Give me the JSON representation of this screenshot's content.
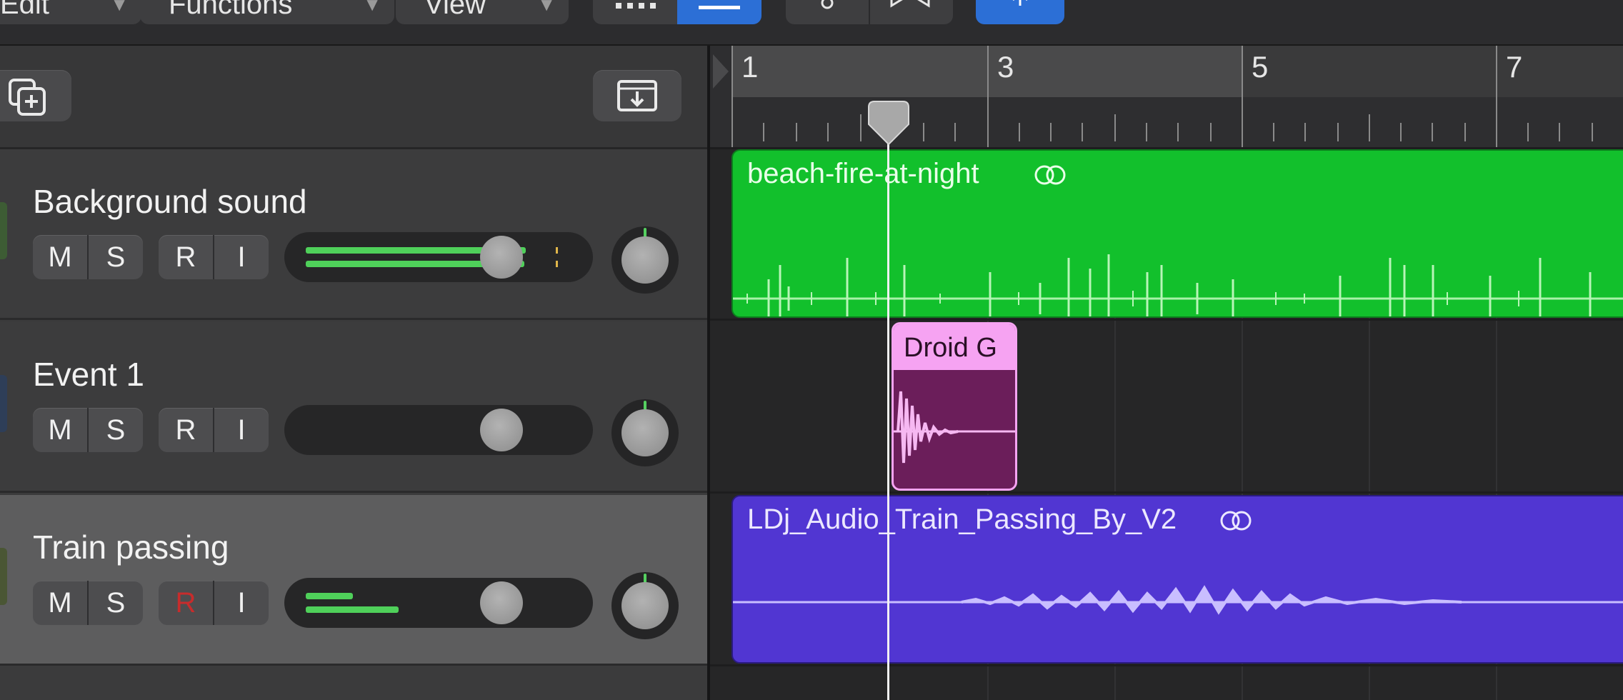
{
  "menubar": {
    "edit": "Edit",
    "functions": "Functions",
    "view": "View"
  },
  "ruler": {
    "bars": [
      "1",
      "3",
      "5",
      "7"
    ]
  },
  "tracks": [
    {
      "name": "Background sound",
      "color": "#3d8a3a",
      "mute": "M",
      "solo": "S",
      "record": "R",
      "input": "I",
      "record_armed": false,
      "volume": 0.72,
      "selected": false
    },
    {
      "name": "Event 1",
      "color": "#2f4f7a",
      "mute": "M",
      "solo": "S",
      "record": "R",
      "input": "I",
      "record_armed": false,
      "volume": 0.72,
      "selected": false
    },
    {
      "name": "Train passing",
      "color": "#4a5a3a",
      "mute": "M",
      "solo": "S",
      "record": "R",
      "input": "I",
      "record_armed": true,
      "volume": 0.72,
      "selected": true
    }
  ],
  "regions": [
    {
      "name": "beach-fire-at-night",
      "color": "#12c02c",
      "looped": true
    },
    {
      "name": "Droid G",
      "color": "#f6a3f2",
      "looped": false
    },
    {
      "name": "LDj_Audio_Train_Passing_By_V2",
      "color": "#5136d2",
      "looped": true
    }
  ],
  "colors": {
    "accent_blue": "#2c6fd6",
    "record_red": "#c72c2c",
    "meter_green": "#4fd05a"
  },
  "icons": {
    "new_track": "new-track-icon",
    "download": "download-icon",
    "loop": "loop-icon"
  }
}
